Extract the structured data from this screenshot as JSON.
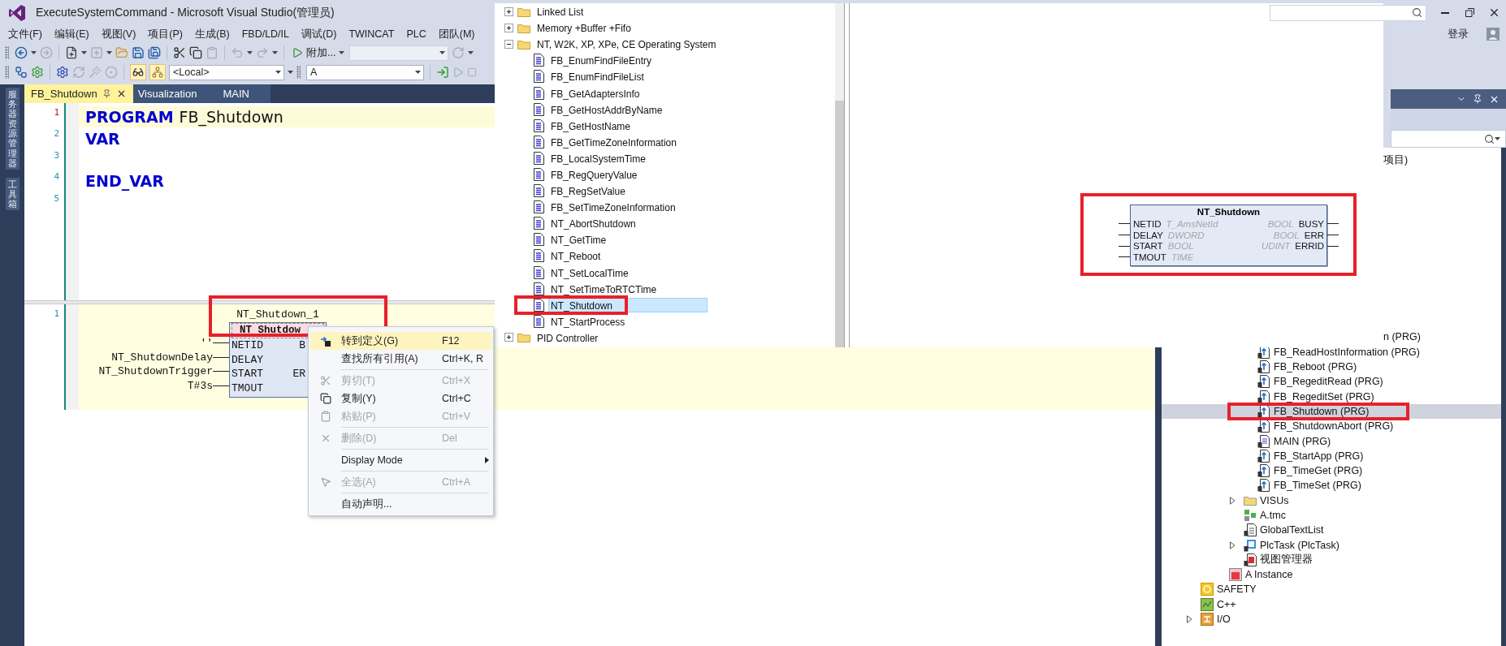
{
  "window": {
    "title": "ExecuteSystemCommand - Microsoft Visual Studio(管理员)"
  },
  "menu_bar": [
    "文件(F)",
    "编辑(E)",
    "视图(V)",
    "项目(P)",
    "生成(B)",
    "FBD/LD/IL",
    "调试(D)",
    "TWINCAT",
    "PLC",
    "团队(M)"
  ],
  "account": {
    "label": "登录"
  },
  "toolbar": {
    "start_label": "附加...",
    "platform": "<Local>",
    "project": "A"
  },
  "side_tabs": [
    "服务器资源管理器",
    "工具箱"
  ],
  "editor_tabs": [
    {
      "label": "FB_Shutdown",
      "selected": true
    },
    {
      "label": "Visualization",
      "selected": false
    },
    {
      "label": "MAIN",
      "selected": false
    }
  ],
  "declaration": [
    {
      "number": "1",
      "changed": true,
      "current": true,
      "tokens": [
        {
          "kind": "keyword",
          "text": "PROGRAM"
        },
        {
          "kind": "identifier",
          "text": "FB_Shutdown"
        }
      ]
    },
    {
      "number": "2",
      "changed": false,
      "current": false,
      "tokens": [
        {
          "kind": "keyword",
          "text": "VAR"
        }
      ]
    },
    {
      "number": "3",
      "changed": false,
      "current": false
    },
    {
      "number": "4",
      "changed": false,
      "current": false,
      "tokens": [
        {
          "kind": "keyword",
          "text": "END_VAR"
        }
      ]
    },
    {
      "number": "5",
      "changed": false,
      "current": false
    }
  ],
  "network": {
    "number": "1",
    "instance": "NT_Shutdown_1",
    "block": "NT_Shutdow",
    "framed": true,
    "pins": [
      {
        "input": "NETID",
        "arg": "''",
        "output": "B"
      },
      {
        "input": "DELAY",
        "arg": "NT_ShutdownDelay"
      },
      {
        "input": "START",
        "arg": "NT_ShutdownTrigger",
        "output": "ER"
      },
      {
        "input": "TMOUT",
        "arg": "T#3s"
      }
    ]
  },
  "context_menu": [
    {
      "kind": "item",
      "label": "转到定义(G)",
      "shortcut": "F12",
      "disabled": false,
      "selected": true
    },
    {
      "kind": "item",
      "label": "查找所有引用(A)",
      "shortcut": "Ctrl+K, R",
      "disabled": false,
      "selected": false
    },
    {
      "kind": "separator"
    },
    {
      "kind": "item",
      "label": "剪切(T)",
      "shortcut": "Ctrl+X",
      "disabled": true,
      "selected": false
    },
    {
      "kind": "item",
      "label": "复制(Y)",
      "shortcut": "Ctrl+C",
      "disabled": false,
      "selected": false
    },
    {
      "kind": "item",
      "label": "粘贴(P)",
      "shortcut": "Ctrl+V",
      "disabled": true,
      "selected": false
    },
    {
      "kind": "separator"
    },
    {
      "kind": "item",
      "label": "删除(D)",
      "shortcut": "Del",
      "disabled": true,
      "selected": false
    },
    {
      "kind": "separator"
    },
    {
      "kind": "submenu",
      "label": "Display Mode",
      "disabled": false,
      "selected": false
    },
    {
      "kind": "separator"
    },
    {
      "kind": "item",
      "label": "全选(A)",
      "shortcut": "Ctrl+A",
      "disabled": true,
      "selected": false
    },
    {
      "kind": "separator"
    },
    {
      "kind": "item",
      "label": "自动声明...",
      "disabled": false,
      "selected": false
    }
  ],
  "library_tree": [
    {
      "label": "Linked List",
      "expanded": false,
      "selected": false
    },
    {
      "label": "Memory +Buffer +Fifo",
      "expanded": false,
      "selected": false
    },
    {
      "label": "NT, W2K, XP, XPe, CE Operating System",
      "expanded": true,
      "selected": false,
      "children": [
        {
          "label": "FB_EnumFindFileEntry",
          "selected": false,
          "framed": false
        },
        {
          "label": "FB_EnumFindFileList",
          "selected": false,
          "framed": false
        },
        {
          "label": "FB_GetAdaptersInfo",
          "selected": false,
          "framed": false
        },
        {
          "label": "FB_GetHostAddrByName",
          "selected": false,
          "framed": false
        },
        {
          "label": "FB_GetHostName",
          "selected": false,
          "framed": false
        },
        {
          "label": "FB_GetTimeZoneInformation",
          "selected": false,
          "framed": false
        },
        {
          "label": "FB_LocalSystemTime",
          "selected": false,
          "framed": false
        },
        {
          "label": "FB_RegQueryValue",
          "selected": false,
          "framed": false
        },
        {
          "label": "FB_RegSetValue",
          "selected": false,
          "framed": false
        },
        {
          "label": "FB_SetTimeZoneInformation",
          "selected": false,
          "framed": false
        },
        {
          "label": "NT_AbortShutdown",
          "selected": false,
          "framed": false
        },
        {
          "label": "NT_GetTime",
          "selected": false,
          "framed": false
        },
        {
          "label": "NT_Reboot",
          "selected": false,
          "framed": false
        },
        {
          "label": "NT_SetLocalTime",
          "selected": false,
          "framed": false
        },
        {
          "label": "NT_SetTimeToRTCTime",
          "selected": false,
          "framed": false
        },
        {
          "label": "NT_Shutdown",
          "selected": true,
          "framed": true
        },
        {
          "label": "NT_StartProcess",
          "selected": false,
          "framed": false
        }
      ]
    },
    {
      "label": "PID Controller",
      "expanded": false,
      "selected": false
    }
  ],
  "fb_preview": {
    "title": "NT_Shutdown",
    "framed": true,
    "inputs": [
      {
        "name": "NETID",
        "type": "T_AmsNetId"
      },
      {
        "name": "DELAY",
        "type": "DWORD"
      },
      {
        "name": "START",
        "type": "BOOL"
      },
      {
        "name": "TMOUT",
        "type": "TIME"
      }
    ],
    "outputs": [
      {
        "name": "BUSY",
        "type": "BOOL"
      },
      {
        "name": "ERR",
        "type": "BOOL"
      },
      {
        "name": "ERRID",
        "type": "UDINT"
      }
    ]
  },
  "solution_explorer": {
    "partial_rows": [
      "项目)",
      "n (PRG)"
    ],
    "pous": [
      {
        "label": "FB_ReadHostInformation (PRG)",
        "kind": "prg",
        "selected": false,
        "framed": false
      },
      {
        "label": "FB_Reboot (PRG)",
        "kind": "prg",
        "selected": false,
        "framed": false
      },
      {
        "label": "FB_RegeditRead (PRG)",
        "kind": "prg",
        "selected": false,
        "framed": false
      },
      {
        "label": "FB_RegeditSet (PRG)",
        "kind": "prg",
        "selected": false,
        "framed": false
      },
      {
        "label": "FB_Shutdown (PRG)",
        "kind": "prg",
        "selected": true,
        "framed": true
      },
      {
        "label": "FB_ShutdownAbort (PRG)",
        "kind": "prg",
        "selected": false,
        "framed": false
      },
      {
        "label": "MAIN (PRG)",
        "kind": "main",
        "selected": false,
        "framed": false
      },
      {
        "label": "FB_StartApp (PRG)",
        "kind": "prg",
        "selected": false,
        "framed": false
      },
      {
        "label": "FB_TimeGet (PRG)",
        "kind": "prg",
        "selected": false,
        "framed": false
      },
      {
        "label": "FB_TimeSet (PRG)",
        "kind": "prg",
        "selected": false,
        "framed": false
      }
    ],
    "project_items": [
      {
        "label": "VISUs",
        "kind": "folder",
        "expandable": true,
        "selected": false
      },
      {
        "label": "A.tmc",
        "kind": "tmc",
        "expandable": false,
        "selected": false
      },
      {
        "label": "GlobalTextList",
        "kind": "textlist",
        "expandable": false,
        "selected": false
      },
      {
        "label": "PlcTask (PlcTask)",
        "kind": "task",
        "expandable": true,
        "selected": false
      },
      {
        "label": "视图管理器",
        "kind": "viewmanager",
        "expandable": false,
        "selected": false
      }
    ],
    "instances": [
      {
        "label": "A Instance",
        "kind": "instance",
        "selected": false
      }
    ],
    "roots": [
      {
        "label": "SAFETY",
        "kind": "safety",
        "expandable": false,
        "selected": false
      },
      {
        "label": "C++",
        "kind": "cpp",
        "expandable": false,
        "selected": false
      },
      {
        "label": "I/O",
        "kind": "io",
        "expandable": true,
        "selected": false
      }
    ]
  }
}
